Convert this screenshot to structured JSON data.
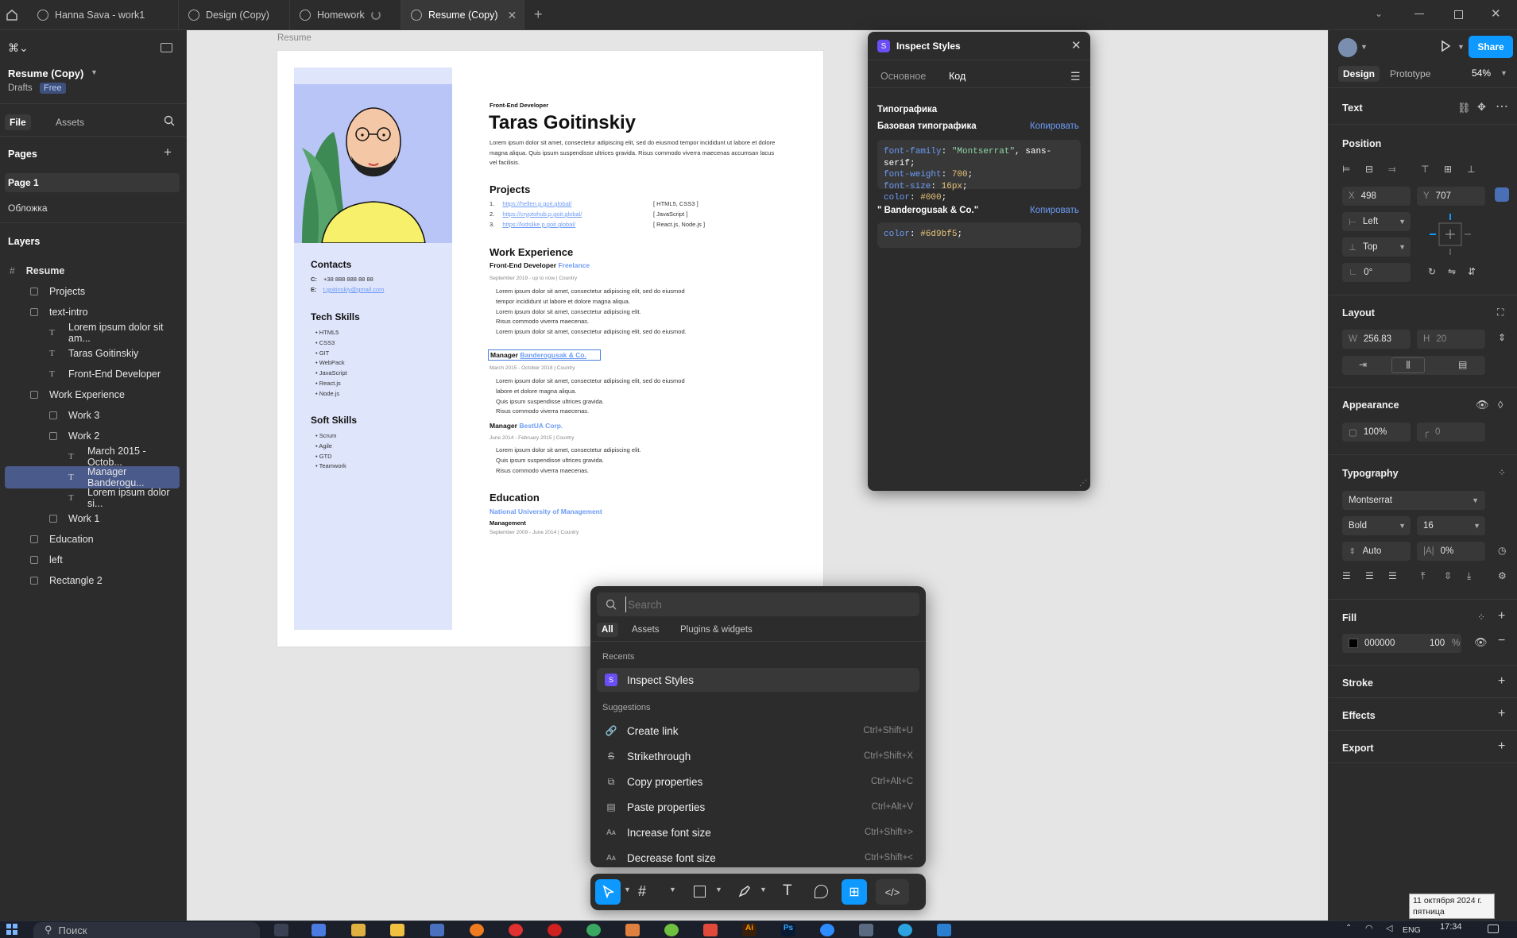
{
  "tabs": [
    {
      "label": "Hanna Sava - work1"
    },
    {
      "label": "Design (Copy)"
    },
    {
      "label": "Homework"
    },
    {
      "label": "Resume (Copy)"
    }
  ],
  "left_panel": {
    "file_name": "Resume (Copy)",
    "location": "Drafts",
    "plan_badge": "Free",
    "tab_file": "File",
    "tab_assets": "Assets",
    "pages_title": "Pages",
    "pages": [
      "Page 1",
      "Обложка"
    ],
    "layers_title": "Layers",
    "layers": [
      {
        "label": "Resume"
      },
      {
        "label": "Projects"
      },
      {
        "label": "text-intro"
      },
      {
        "label": "Lorem ipsum dolor sit am..."
      },
      {
        "label": "Taras Goitinskiy"
      },
      {
        "label": "Front-End Developer"
      },
      {
        "label": "Work Experience"
      },
      {
        "label": "Work 3"
      },
      {
        "label": "Work 2"
      },
      {
        "label": "March 2015 - Octob..."
      },
      {
        "label": "Manager Banderogu..."
      },
      {
        "label": "Lorem ipsum dolor si..."
      },
      {
        "label": "Work 1"
      },
      {
        "label": "Education"
      },
      {
        "label": "left"
      },
      {
        "label": "Rectangle 2"
      }
    ]
  },
  "canvas": {
    "frame_label": "Resume",
    "resume": {
      "role": "Front-End Developer",
      "name": "Taras Goitinskiy",
      "intro": "Lorem ipsum dolor sit amet, consectetur adipiscing elit, sed do eiusmod tempor incididunt ut labore et dolore magna aliqua. Quis ipsum suspendisse ultrices gravida. Risus commodo viverra maecenas accumsan lacus vel facilisis.",
      "projects_title": "Projects",
      "projects": [
        {
          "num": "1.",
          "url": "https://hellen.p.goit.global/",
          "tech": "[ HTML5, CSS3 ]"
        },
        {
          "num": "2.",
          "url": "https://cryptohub.p.goit.global/",
          "tech": "[ JavaScript ]"
        },
        {
          "num": "3.",
          "url": "https://kidslike.p.goit.global/",
          "tech": "[ React.js, Node.js ]"
        }
      ],
      "work_title": "Work Experience",
      "work1_role": "Front-End Developer",
      "work1_company": "Freelance",
      "work1_date": "September 2019 - up to now  |  Country",
      "work1_items": [
        "Lorem ipsum dolor sit amet, consectetur adipiscing elit, sed do eiusmod tempor incididunt ut labore et dolore magna aliqua.",
        "Lorem ipsum dolor sit amet, consectetur adipiscing elit.",
        "Risus commodo viverra maecenas.",
        "Lorem ipsum dolor sit amet, consectetur adipiscing elit, sed do eiusmod."
      ],
      "work2_role": "Manager",
      "work2_company": "Banderogusak & Co.",
      "work2_date": "March 2015 - October 2018  |  Country",
      "work2_items": [
        "Lorem ipsum dolor sit amet, consectetur adipiscing elit, sed do eiusmod labore et dolore magna aliqua.",
        "Quis ipsum suspendisse ultrices gravida.",
        "Risus commodo viverra maecenas."
      ],
      "work3_role": "Manager",
      "work3_company": "BestUA Corp.",
      "work3_date": "June 2014 - February 2015  |  Country",
      "work3_items": [
        "Lorem ipsum dolor sit amet, consectetur adipiscing elit.",
        "Quis ipsum suspendisse ultrices gravida.",
        "Risus commodo viverra maecenas."
      ],
      "education_title": "Education",
      "edu_school": "National University of Management",
      "edu_degree": "Management",
      "edu_date": "September 2009 - June 2014  |  Country",
      "contacts_title": "Contacts",
      "phone_label": "C:",
      "phone": "+38 888 888 88 88",
      "email_label": "E:",
      "email": "t.goitinskiy@gmail.com",
      "tech_title": "Tech Skills",
      "tech_skills": [
        "HTML5",
        "CSS3",
        "GIT",
        "WebPack",
        "JavaScript",
        "React.js",
        "Node.js"
      ],
      "soft_title": "Soft Skills",
      "soft_skills": [
        "Scrum",
        "Agile",
        "GTD",
        "Teamwork"
      ]
    }
  },
  "inspect": {
    "title": "Inspect Styles",
    "tab_basic": "Основное",
    "tab_code": "Код",
    "section": "Типографика",
    "base_label": "Базовая типографика",
    "copy1": "Копировать",
    "code1": [
      {
        "p": "font-family",
        "v": "\"Montserrat\"",
        "r": ", sans-serif;"
      },
      {
        "p": "font-weight",
        "v": "700",
        "r": ";"
      },
      {
        "p": "font-size",
        "v": "16px",
        "r": ";"
      },
      {
        "p": "color",
        "v": "#000",
        "r": ";"
      }
    ],
    "style2_label": "\" Banderogusak & Co.\"",
    "copy2": "Копировать",
    "code2": {
      "p": "color",
      "v": "#6d9bf5",
      "r": ";"
    }
  },
  "palette": {
    "search_placeholder": "Search",
    "tab_all": "All",
    "tab_assets": "Assets",
    "tab_plugins": "Plugins & widgets",
    "recents_title": "Recents",
    "recent_item": "Inspect Styles",
    "suggestions_title": "Suggestions",
    "suggestions": [
      {
        "label": "Create link",
        "shortcut": "Ctrl+Shift+U",
        "icon": "🔗"
      },
      {
        "label": "Strikethrough",
        "shortcut": "Ctrl+Shift+X",
        "icon": "S"
      },
      {
        "label": "Copy properties",
        "shortcut": "Ctrl+Alt+C",
        "icon": "⧉"
      },
      {
        "label": "Paste properties",
        "shortcut": "Ctrl+Alt+V",
        "icon": "▤"
      },
      {
        "label": "Increase font size",
        "shortcut": "Ctrl+Shift+>",
        "icon": "Aᴀ"
      },
      {
        "label": "Decrease font size",
        "shortcut": "Ctrl+Shift+<",
        "icon": "Aᴀ"
      }
    ]
  },
  "right_panel": {
    "tab_design": "Design",
    "tab_prototype": "Prototype",
    "zoom": "54%",
    "share": "Share",
    "layer_type": "Text",
    "position_title": "Position",
    "x_label": "X",
    "x": "498",
    "y_label": "Y",
    "y": "707",
    "h_constraint": "Left",
    "v_constraint": "Top",
    "rotation": "0°",
    "layout_title": "Layout",
    "w_label": "W",
    "w": "256.83",
    "h_label": "H",
    "h": "20",
    "appearance_title": "Appearance",
    "opacity": "100%",
    "radius": "0",
    "typography_title": "Typography",
    "font": "Montserrat",
    "weight": "Bold",
    "size": "16",
    "line_height": "Auto",
    "letter_spacing": "0%",
    "fill_title": "Fill",
    "fill_hex": "000000",
    "fill_opacity": "100",
    "fill_pct": "%",
    "stroke_title": "Stroke",
    "effects_title": "Effects",
    "export_title": "Export"
  },
  "taskbar": {
    "search": "Поиск",
    "lang": "ENG",
    "time": "17:34",
    "date": "11 октября 2024 г.",
    "weekday": "пятница"
  },
  "colors": {
    "accent": "#0d99ff",
    "link": "#6d9bf5",
    "resume_left": "#dfe5fb",
    "photo_bg": "#b9c4f7"
  }
}
